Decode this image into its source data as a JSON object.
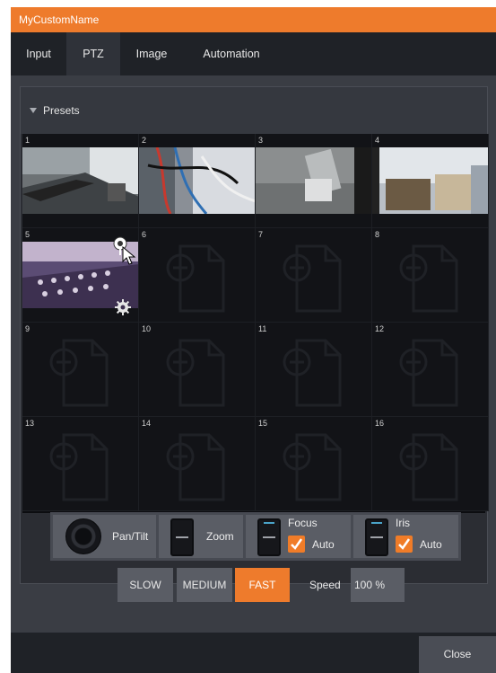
{
  "window": {
    "title": "MyCustomName"
  },
  "tabs": [
    {
      "label": "Input",
      "active": false
    },
    {
      "label": "PTZ",
      "active": true
    },
    {
      "label": "Image",
      "active": false
    },
    {
      "label": "Automation",
      "active": false
    }
  ],
  "presets": {
    "header": "Presets",
    "cells": [
      {
        "number": "1",
        "state": "thumbnail"
      },
      {
        "number": "2",
        "state": "thumbnail"
      },
      {
        "number": "3",
        "state": "thumbnail"
      },
      {
        "number": "4",
        "state": "thumbnail"
      },
      {
        "number": "5",
        "state": "thumbnail-hover"
      },
      {
        "number": "6",
        "state": "empty"
      },
      {
        "number": "7",
        "state": "empty"
      },
      {
        "number": "8",
        "state": "empty"
      },
      {
        "number": "9",
        "state": "empty"
      },
      {
        "number": "10",
        "state": "empty"
      },
      {
        "number": "11",
        "state": "empty"
      },
      {
        "number": "12",
        "state": "empty"
      },
      {
        "number": "13",
        "state": "empty"
      },
      {
        "number": "14",
        "state": "empty"
      },
      {
        "number": "15",
        "state": "empty"
      },
      {
        "number": "16",
        "state": "empty"
      }
    ]
  },
  "controls": {
    "pan_tilt_label": "Pan/Tilt",
    "zoom_label": "Zoom",
    "focus": {
      "label": "Focus",
      "auto_label": "Auto",
      "auto_checked": true
    },
    "iris": {
      "label": "Iris",
      "auto_label": "Auto",
      "auto_checked": true
    }
  },
  "speed": {
    "buttons": [
      "SLOW",
      "MEDIUM",
      "FAST"
    ],
    "selected": "FAST",
    "label": "Speed",
    "value": "100 %"
  },
  "footer": {
    "close_label": "Close"
  },
  "colors": {
    "accent": "#ee7b2c",
    "panel": "#2b2d33",
    "background": "#3a3d44"
  }
}
